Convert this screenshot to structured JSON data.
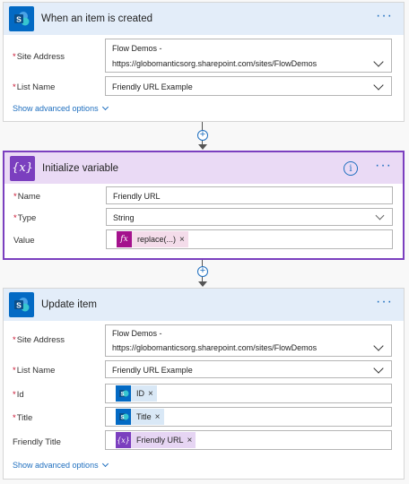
{
  "trigger": {
    "title": "When an item is created",
    "site_address_label": "Site Address",
    "site_address_line1": "Flow Demos -",
    "site_address_line2": "https://globomanticsorg.sharepoint.com/sites/FlowDemos",
    "list_name_label": "List Name",
    "list_name_value": "Friendly URL Example",
    "advanced_label": "Show advanced options"
  },
  "init_var": {
    "title": "Initialize variable",
    "name_label": "Name",
    "name_value": "Friendly URL",
    "type_label": "Type",
    "type_value": "String",
    "value_label": "Value",
    "value_token": "replace(...)",
    "token_remove": "×"
  },
  "update": {
    "title": "Update item",
    "site_address_label": "Site Address",
    "site_address_line1": "Flow Demos -",
    "site_address_line2": "https://globomanticsorg.sharepoint.com/sites/FlowDemos",
    "list_name_label": "List Name",
    "list_name_value": "Friendly URL Example",
    "id_label": "Id",
    "id_token": "ID",
    "title_label": "Title",
    "title_token": "Title",
    "friendly_label": "Friendly Title",
    "friendly_token": "Friendly URL",
    "token_remove": "×",
    "advanced_label": "Show advanced options"
  },
  "common": {
    "required_mark": "*",
    "more_glyph": "···",
    "info_glyph": "i",
    "plus_glyph": "+",
    "var_glyph": "{x}",
    "fx_glyph": "fx"
  },
  "colors": {
    "sharepoint_blue": "#036ac4",
    "variable_purple": "#7b3fbf",
    "expression_magenta": "#a4128d",
    "link_blue": "#1f6fbf",
    "required_red": "#c8102e"
  }
}
